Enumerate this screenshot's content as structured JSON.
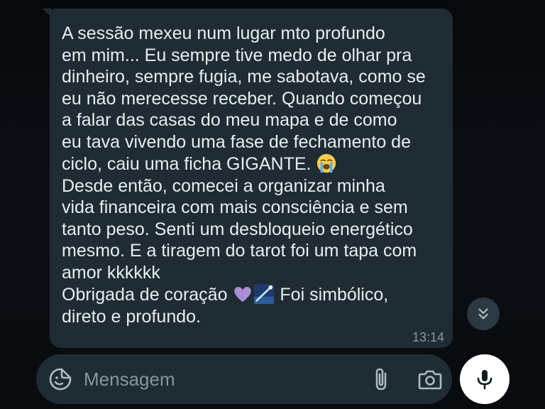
{
  "message": {
    "paragraph_1_lines": [
      "A sessão mexeu num lugar mto profundo",
      "em mim... Eu sempre tive medo de olhar pra",
      "dinheiro, sempre fugia, me sabotava, como se",
      "eu não merecesse receber. Quando começou",
      "a falar das casas do meu mapa e de como",
      "eu tava vivendo uma fase de fechamento de",
      "ciclo, caiu uma ficha GIGANTE."
    ],
    "paragraph_2_lines": [
      "Desde então, comecei a organizar minha",
      "vida financeira com mais consciência e sem",
      "tanto peso. Senti um desbloqueio energético",
      "mesmo. E a tiragem do tarot foi um tapa com",
      "amor kkkkkk"
    ],
    "paragraph_3_line_1_start": "Obrigada de coração",
    "paragraph_3_line_1_end": "Foi simbólico,",
    "paragraph_3_line_2": "direto e profundo.",
    "time": "13:14",
    "emojis": [
      "loudly-crying-face",
      "purple-heart",
      "shooting-star"
    ]
  },
  "composer": {
    "placeholder": "Mensagem"
  },
  "icons": {
    "emoji_button": "sticker-smiley-icon",
    "attach_button": "paperclip-icon",
    "camera_button": "camera-icon",
    "mic_button": "microphone-icon",
    "scroll_down": "double-chevron-down-icon"
  },
  "colors": {
    "bubble": "#1f2c34",
    "text": "#e9edef",
    "muted": "#8696a0",
    "mic_bg": "#ffffff"
  }
}
